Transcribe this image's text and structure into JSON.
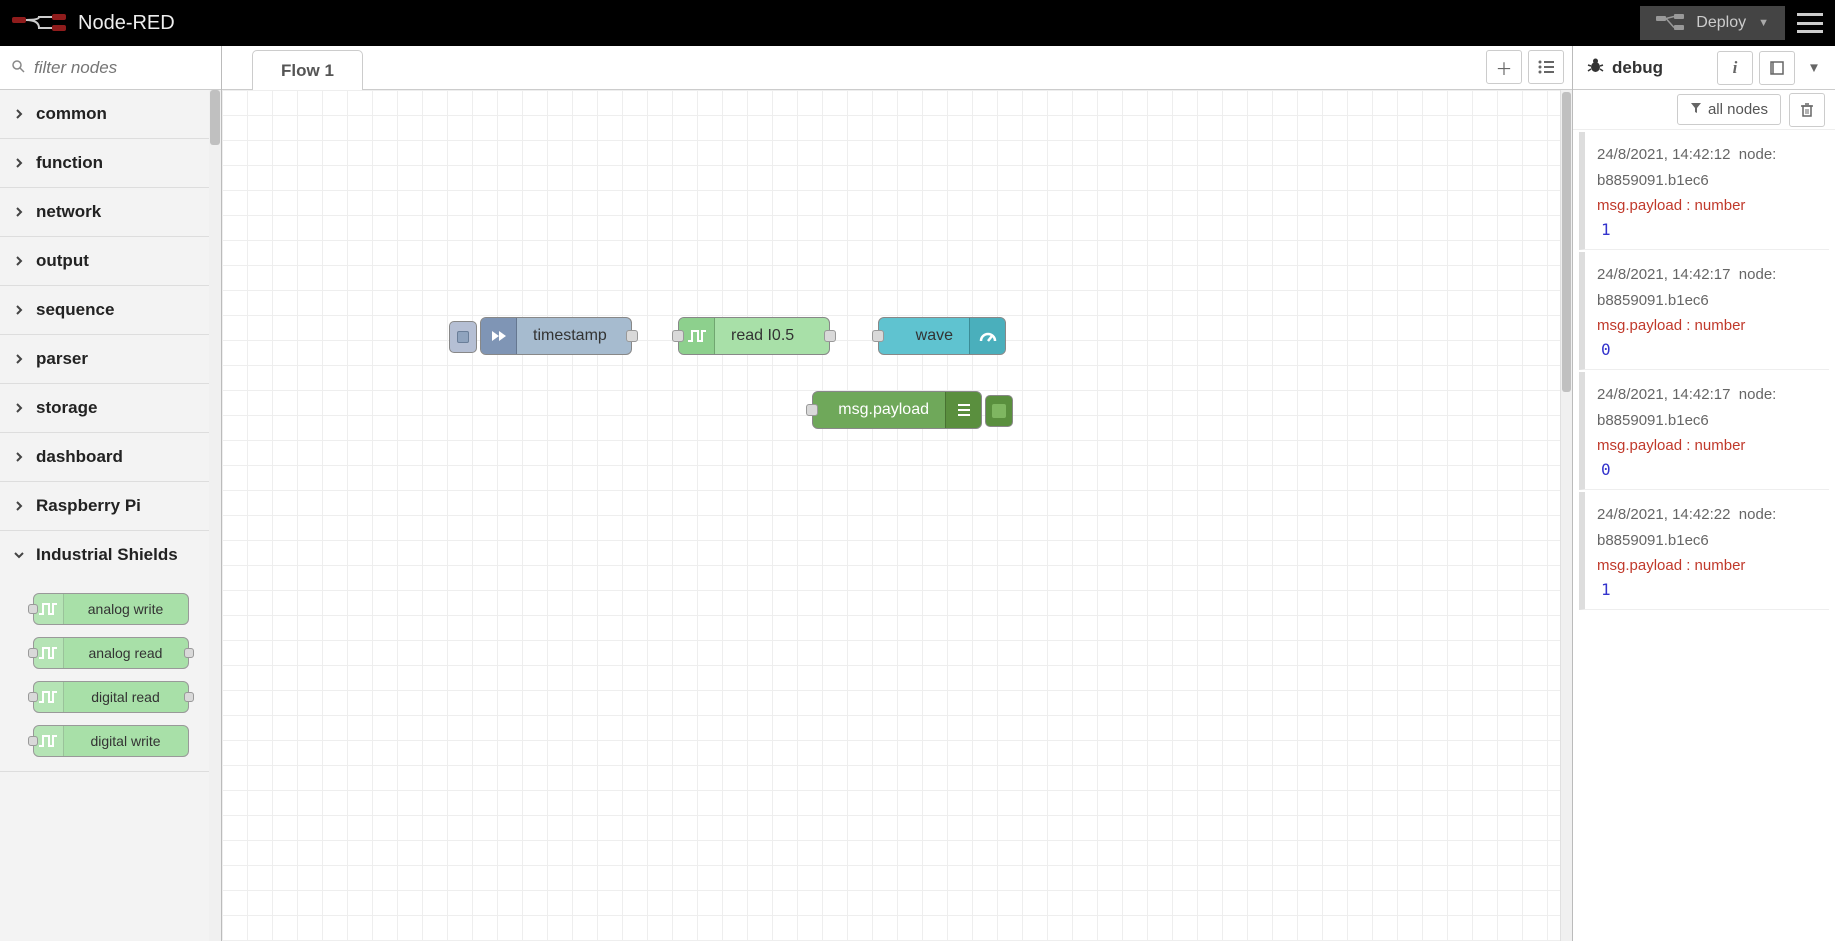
{
  "header": {
    "app_name": "Node-RED",
    "deploy_label": "Deploy"
  },
  "palette": {
    "filter_placeholder": "filter nodes",
    "categories": [
      {
        "label": "common",
        "expanded": false
      },
      {
        "label": "function",
        "expanded": false
      },
      {
        "label": "network",
        "expanded": false
      },
      {
        "label": "output",
        "expanded": false
      },
      {
        "label": "sequence",
        "expanded": false
      },
      {
        "label": "parser",
        "expanded": false
      },
      {
        "label": "storage",
        "expanded": false
      },
      {
        "label": "dashboard",
        "expanded": false
      },
      {
        "label": "Raspberry Pi",
        "expanded": false
      },
      {
        "label": "Industrial Shields",
        "expanded": true,
        "nodes": [
          {
            "label": "analog write",
            "in": true,
            "out": false
          },
          {
            "label": "analog read",
            "in": true,
            "out": true
          },
          {
            "label": "digital read",
            "in": true,
            "out": true
          },
          {
            "label": "digital write",
            "in": true,
            "out": false
          }
        ]
      }
    ]
  },
  "workspace": {
    "tab_label": "Flow 1",
    "nodes": {
      "inject": {
        "label": "timestamp",
        "color": "#a6bbcf",
        "icon_bg": "#7f95b5"
      },
      "read": {
        "label": "read I0.5",
        "color": "#a8e0a8",
        "icon_bg": "#8dd08d"
      },
      "wave": {
        "label": "wave",
        "color": "#5fc3d0",
        "icon_bg": "#4aafbc"
      },
      "debug": {
        "label": "msg.payload",
        "color": "#6fa85a",
        "icon_bg": "#5a8f3e"
      }
    }
  },
  "sidebar": {
    "title": "debug",
    "filter_label": "all nodes",
    "messages": [
      {
        "time": "24/8/2021, 14:42:12",
        "node_prefix": "node:",
        "node": "b8859091.b1ec6",
        "topic": "msg.payload : number",
        "value": "1"
      },
      {
        "time": "24/8/2021, 14:42:17",
        "node_prefix": "node:",
        "node": "b8859091.b1ec6",
        "topic": "msg.payload : number",
        "value": "0"
      },
      {
        "time": "24/8/2021, 14:42:17",
        "node_prefix": "node:",
        "node": "b8859091.b1ec6",
        "topic": "msg.payload : number",
        "value": "0"
      },
      {
        "time": "24/8/2021, 14:42:22",
        "node_prefix": "node:",
        "node": "b8859091.b1ec6",
        "topic": "msg.payload : number",
        "value": "1"
      }
    ]
  }
}
